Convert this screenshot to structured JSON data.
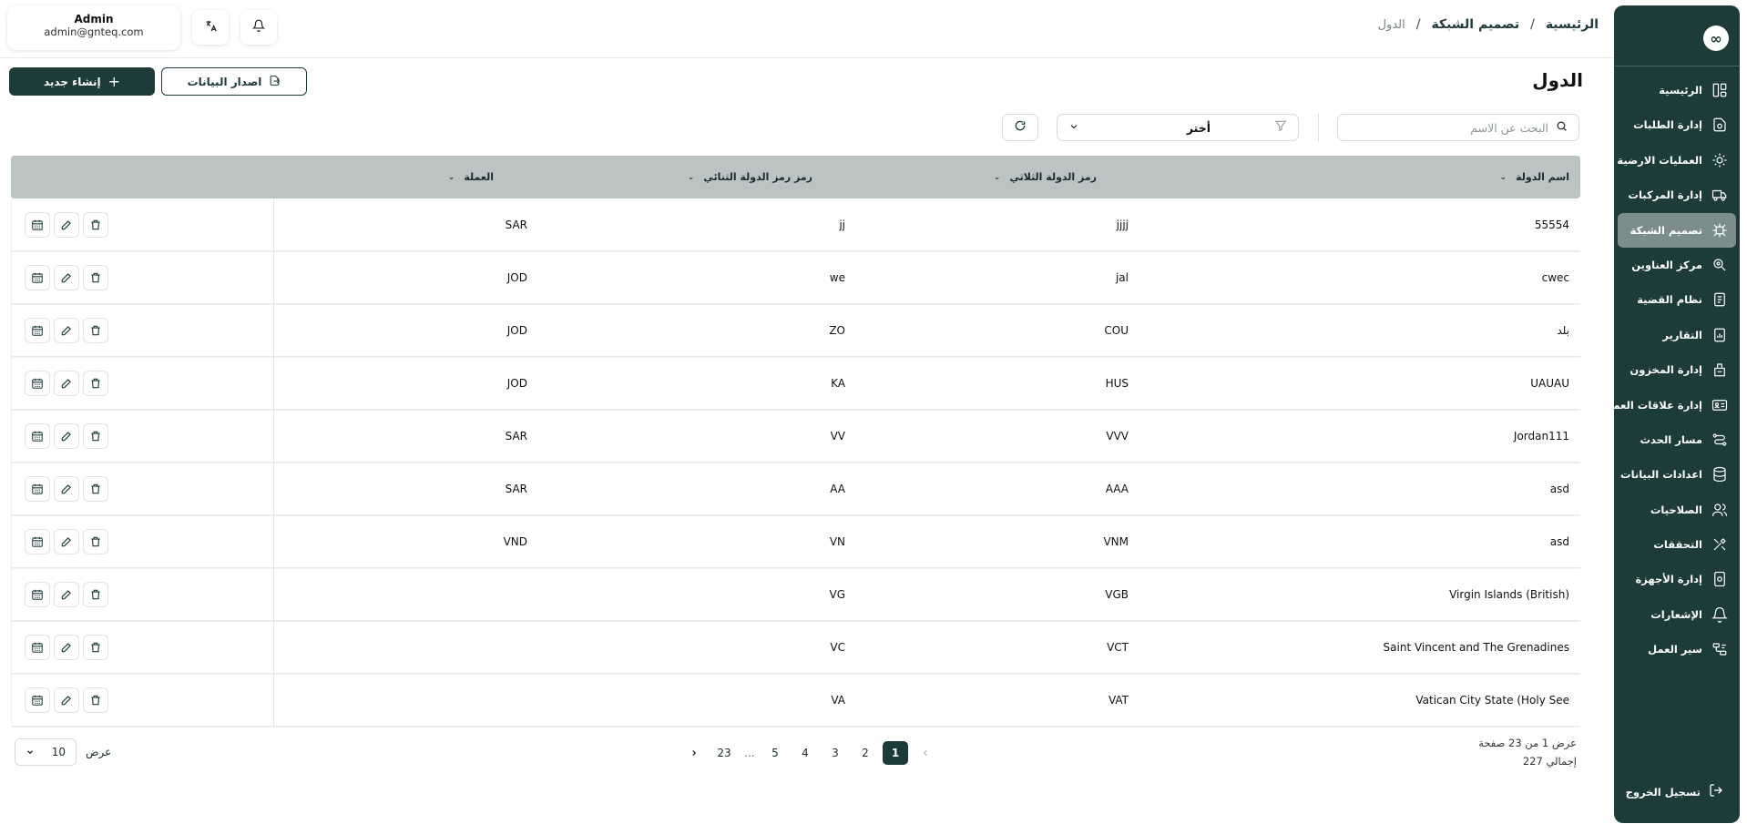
{
  "header": {
    "breadcrumb": [
      "الرئيسية",
      "تصميم الشبكة",
      "الدول"
    ],
    "breadcrumb_sep": "/",
    "user_name": "Admin",
    "user_email": "admin@gnteq.com"
  },
  "sidebar": {
    "logo": "∞",
    "items": [
      {
        "label": "الرئيسية",
        "icon": "dashboard-icon",
        "active": false
      },
      {
        "label": "إدارة الطلبات",
        "icon": "orders-icon",
        "active": false
      },
      {
        "label": "العمليات الارضية",
        "icon": "ground-ops-icon",
        "active": false
      },
      {
        "label": "إدارة المركبات",
        "icon": "truck-icon",
        "active": false
      },
      {
        "label": "تصميم الشبكة",
        "icon": "network-icon",
        "active": true
      },
      {
        "label": "مركز العناوين",
        "icon": "location-icon",
        "active": false
      },
      {
        "label": "نظام القضية",
        "icon": "case-icon",
        "active": false
      },
      {
        "label": "التقارير",
        "icon": "reports-icon",
        "active": false
      },
      {
        "label": "إدارة المخزون",
        "icon": "inventory-icon",
        "active": false
      },
      {
        "label": "إدارة علاقات العملاء",
        "icon": "crm-icon",
        "active": false
      },
      {
        "label": "مسار الحدث",
        "icon": "route-icon",
        "active": false
      },
      {
        "label": "اعدادات البيانات",
        "icon": "database-icon",
        "active": false
      },
      {
        "label": "الصلاحيات",
        "icon": "users-icon",
        "active": false
      },
      {
        "label": "التحققات",
        "icon": "tools-icon",
        "active": false
      },
      {
        "label": "إدارة الأجهزة",
        "icon": "devices-icon",
        "active": false
      },
      {
        "label": "الإشعارات",
        "icon": "bell-icon",
        "active": false
      },
      {
        "label": "سير العمل",
        "icon": "workflow-icon",
        "active": false
      }
    ],
    "logout_label": "تسجيل الخروج"
  },
  "page": {
    "title": "الدول",
    "create_label": "إنشاء جديد",
    "export_label": "اصدار البيانات",
    "search_placeholder": "البحث عن الاسم",
    "filter_value": "أختر"
  },
  "table": {
    "columns": [
      "اسم الدولة",
      "رمز الدولة الثلاثي",
      "رمز رمز الدولة الثنائي",
      "العملة"
    ],
    "rows": [
      {
        "name": "55554",
        "iso3": "jjjj",
        "iso2": "jj",
        "currency": "SAR"
      },
      {
        "name": "cwec",
        "iso3": "jal",
        "iso2": "we",
        "currency": "JOD"
      },
      {
        "name": "بلد",
        "iso3": "COU",
        "iso2": "ZO",
        "currency": "JOD"
      },
      {
        "name": "UAUAU",
        "iso3": "HUS",
        "iso2": "KA",
        "currency": "JOD"
      },
      {
        "name": "Jordan111",
        "iso3": "VVV",
        "iso2": "VV",
        "currency": "SAR"
      },
      {
        "name": "asd",
        "iso3": "AAA",
        "iso2": "AA",
        "currency": "SAR"
      },
      {
        "name": "asd",
        "iso3": "VNM",
        "iso2": "VN",
        "currency": "VND"
      },
      {
        "name": "Virgin Islands (British)",
        "iso3": "VGB",
        "iso2": "VG",
        "currency": ""
      },
      {
        "name": "Saint Vincent and The Grenadines",
        "iso3": "VCT",
        "iso2": "VC",
        "currency": ""
      },
      {
        "name": "Vatican City State (Holy See",
        "iso3": "VAT",
        "iso2": "VA",
        "currency": ""
      }
    ]
  },
  "pagination": {
    "pages": [
      "1",
      "2",
      "3",
      "4",
      "5",
      "...",
      "23"
    ],
    "current": "1",
    "info_line1": "عرض 1 من 23 صفحة",
    "info_line2": "إجمالي 227",
    "per_page_label": "عرض",
    "per_page_value": "10"
  }
}
